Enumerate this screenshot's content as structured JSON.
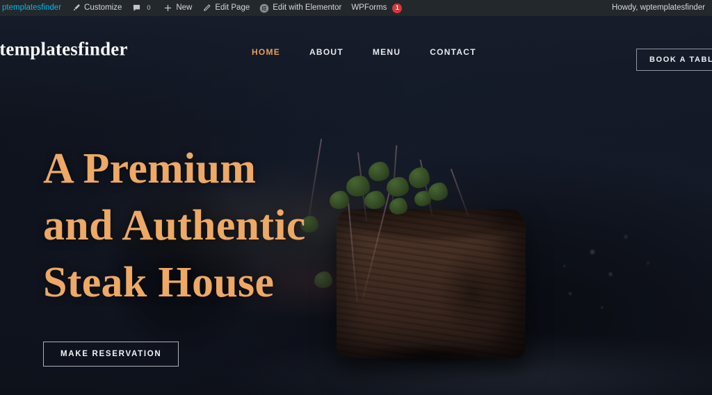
{
  "admin_bar": {
    "site_name": "ptemplatesfinder",
    "customize": {
      "label": "Customize",
      "icon": "paintbrush-icon"
    },
    "comments": {
      "count": "0",
      "icon": "comment-bubble-icon"
    },
    "new": {
      "label": "New",
      "icon": "plus-icon"
    },
    "edit_page": {
      "label": "Edit Page",
      "icon": "pencil-icon"
    },
    "elementor": {
      "label": "Edit with Elementor",
      "icon": "elementor-circle-e-icon"
    },
    "wpforms": {
      "label": "WPForms",
      "badge": "1",
      "badge_color": "#d63638"
    },
    "howdy": "Howdy, wptemplatesfinder"
  },
  "header": {
    "logo": "ptemplatesfinder",
    "nav": [
      {
        "label": "HOME",
        "active": true
      },
      {
        "label": "ABOUT",
        "active": false
      },
      {
        "label": "MENU",
        "active": false
      },
      {
        "label": "CONTACT",
        "active": false
      }
    ],
    "cta": "BOOK A TABLE"
  },
  "hero": {
    "title": "A Premium\nand Authentic\nSteak House",
    "button": "MAKE RESERVATION",
    "image_subject": "seared steak fillet with microgreens on dark plate"
  },
  "colors": {
    "accent": "#eda965",
    "nav_active": "#e3a15c",
    "admin_bar_bg": "#23282d",
    "page_bg": "#141a26",
    "badge_red": "#d63638",
    "text_light": "#eef1f4"
  }
}
